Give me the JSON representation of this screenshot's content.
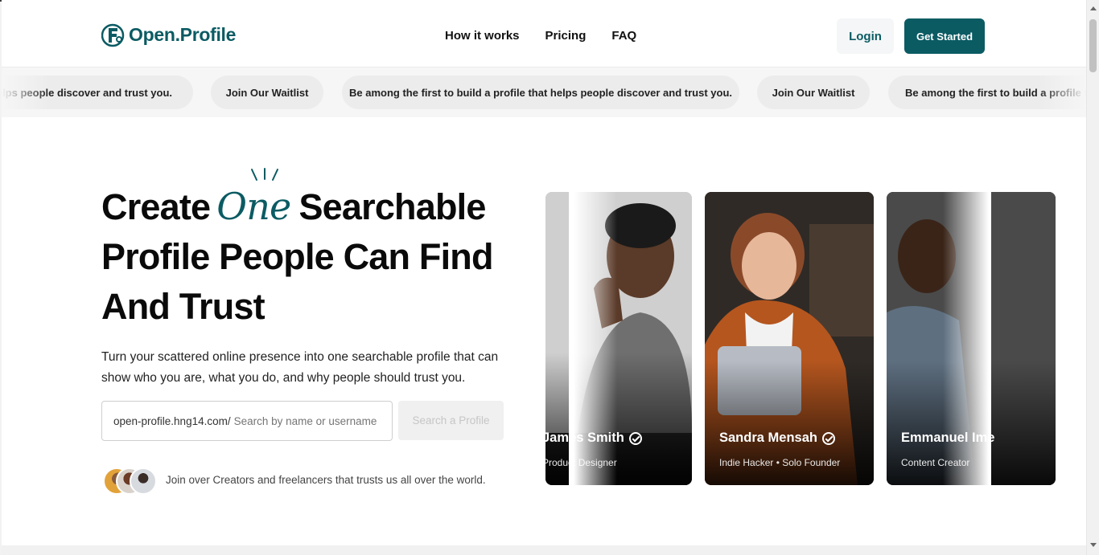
{
  "brand": {
    "name": "Open.Profile",
    "accent": "#0b5b63"
  },
  "nav": {
    "items": [
      "How it works",
      "Pricing",
      "FAQ"
    ]
  },
  "auth": {
    "login": "Login",
    "get_started": "Get Started"
  },
  "marquee": {
    "items": [
      "Be among the first to build a profile that helps people discover and trust you.",
      "Join Our Waitlist",
      "Be among the first to build a profile that helps people discover and trust you.",
      "Join Our Waitlist",
      "Be among the first to build a profile that helps people discover and trust you."
    ]
  },
  "hero": {
    "title_1": "Create",
    "title_accent": "One",
    "title_2": "Searchable Profile People Can Find And Trust",
    "description": "Turn your scattered online presence into one searchable profile that can show who you are, what you do, and why people should trust you.",
    "search_prefix": "open-profile.hng14.com/",
    "search_placeholder": "Search by name or username",
    "search_button": "Search a Profile",
    "trust_text": "Join over Creators and freelancers that trusts us all over the world."
  },
  "cards": [
    {
      "name": "James Smith",
      "role": "Product Designer"
    },
    {
      "name": "Sandra Mensah",
      "role": "Indie Hacker • Solo Founder"
    },
    {
      "name": "Emmanuel Ime",
      "role": "Content Creator"
    }
  ]
}
